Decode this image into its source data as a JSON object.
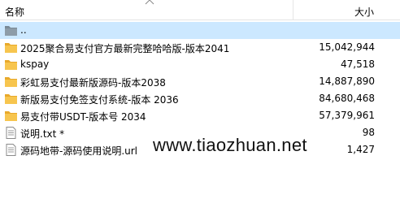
{
  "header": {
    "name_label": "名称",
    "size_label": "大小"
  },
  "files": [
    {
      "name": "..",
      "size": "",
      "icon": "folder-up-icon",
      "selected": true
    },
    {
      "name": "2025聚合易支付官方最新完整哈哈版-版本2041",
      "size": "15,042,944",
      "icon": "folder-icon"
    },
    {
      "name": "kspay",
      "size": "47,518",
      "icon": "folder-icon"
    },
    {
      "name": "彩虹易支付最新版源码-版本2038",
      "size": "14,887,890",
      "icon": "folder-icon"
    },
    {
      "name": "新版易支付免签支付系统-版本 2036",
      "size": "84,680,468",
      "icon": "folder-icon"
    },
    {
      "name": "易支付带USDT-版本号 2034",
      "size": "57,379,961",
      "icon": "folder-icon"
    },
    {
      "name": "说明.txt *",
      "size": "98",
      "icon": "text-file-icon"
    },
    {
      "name": "源码地带-源码使用说明.url",
      "size": "1,427",
      "icon": "text-file-icon"
    }
  ],
  "watermark": "www.tiaozhuan.net",
  "colors": {
    "selection": "#cce8ff",
    "folder": "#f7c54e",
    "folder_up": "#7a8a96"
  }
}
